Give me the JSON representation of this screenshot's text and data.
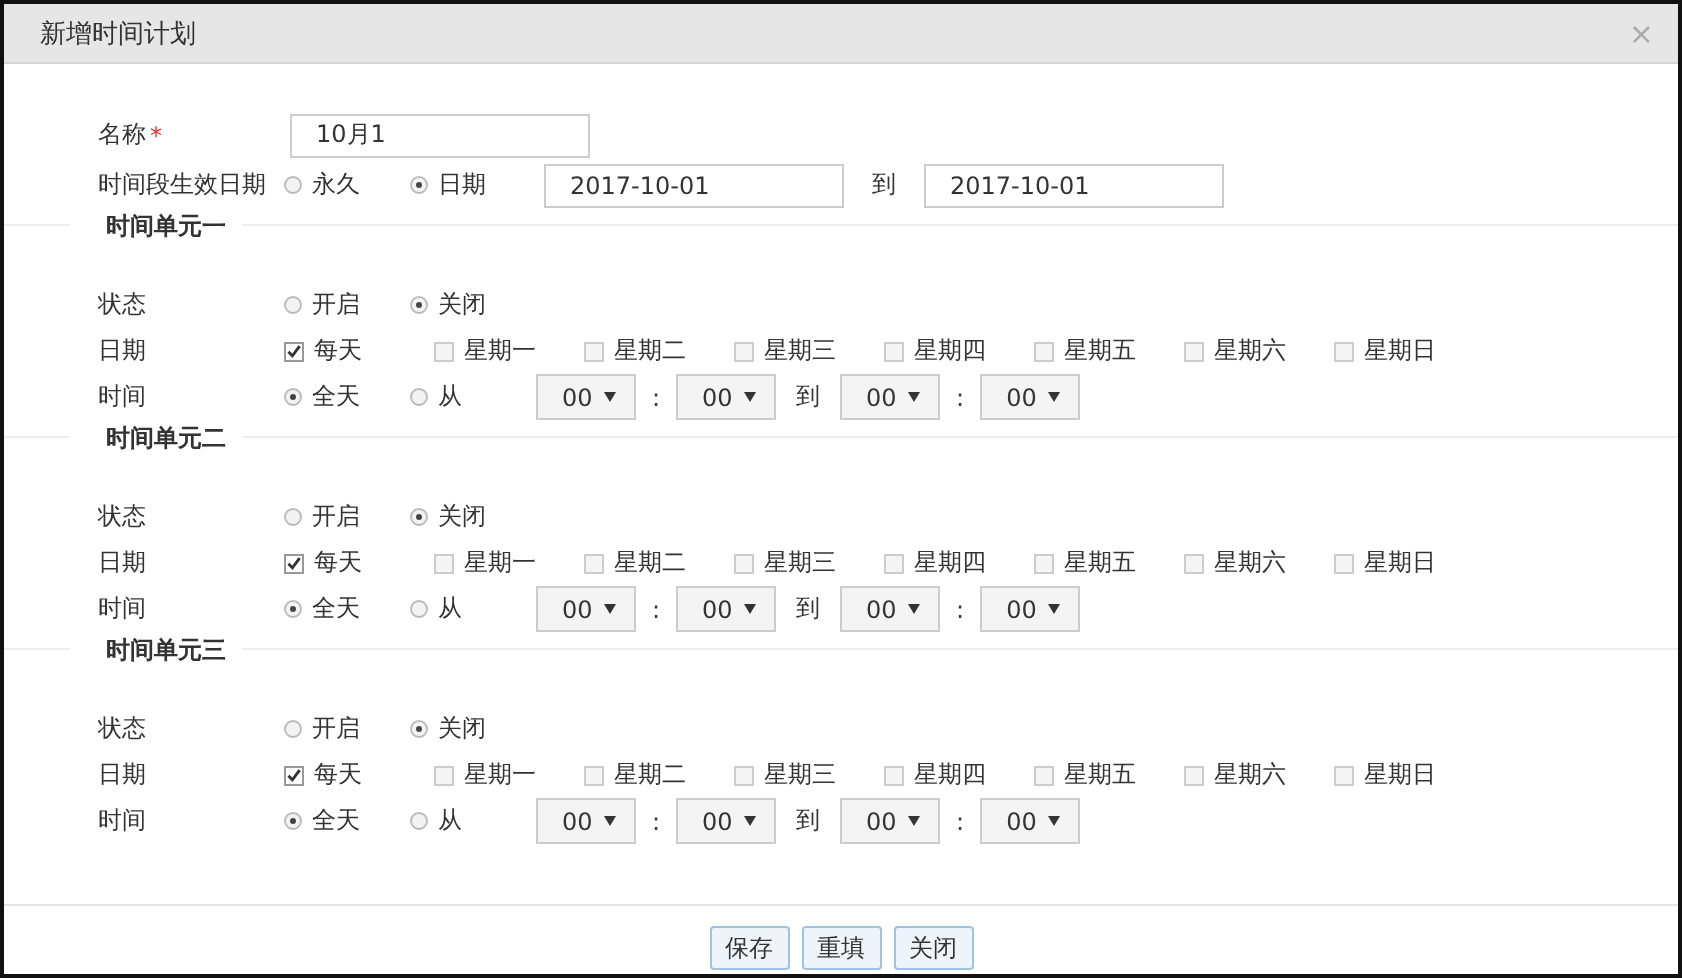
{
  "window": {
    "title": "新增时间计划",
    "close": "×"
  },
  "name": {
    "label": "名称",
    "required": "*",
    "value": "10月1"
  },
  "validity": {
    "label": "时间段生效日期",
    "options": [
      {
        "label": "永久",
        "selected": false
      },
      {
        "label": "日期",
        "selected": true
      }
    ],
    "from": "2017-10-01",
    "to_label": "到",
    "to": "2017-10-01"
  },
  "units": [
    {
      "title": "时间单元一",
      "status": {
        "label": "状态",
        "options": [
          {
            "label": "开启",
            "selected": false
          },
          {
            "label": "关闭",
            "selected": true
          }
        ]
      },
      "days": {
        "label": "日期",
        "items": [
          {
            "label": "每天",
            "checked": true
          },
          {
            "label": "星期一",
            "checked": false
          },
          {
            "label": "星期二",
            "checked": false
          },
          {
            "label": "星期三",
            "checked": false
          },
          {
            "label": "星期四",
            "checked": false
          },
          {
            "label": "星期五",
            "checked": false
          },
          {
            "label": "星期六",
            "checked": false
          },
          {
            "label": "星期日",
            "checked": false
          }
        ]
      },
      "time": {
        "label": "时间",
        "options": [
          {
            "label": "全天",
            "selected": true
          },
          {
            "label": "从",
            "selected": false
          }
        ],
        "start_hour": "00",
        "start_minute": "00",
        "to_label": "到",
        "end_hour": "00",
        "end_minute": "00",
        "sep": ":"
      }
    },
    {
      "title": "时间单元二",
      "status": {
        "label": "状态",
        "options": [
          {
            "label": "开启",
            "selected": false
          },
          {
            "label": "关闭",
            "selected": true
          }
        ]
      },
      "days": {
        "label": "日期",
        "items": [
          {
            "label": "每天",
            "checked": true
          },
          {
            "label": "星期一",
            "checked": false
          },
          {
            "label": "星期二",
            "checked": false
          },
          {
            "label": "星期三",
            "checked": false
          },
          {
            "label": "星期四",
            "checked": false
          },
          {
            "label": "星期五",
            "checked": false
          },
          {
            "label": "星期六",
            "checked": false
          },
          {
            "label": "星期日",
            "checked": false
          }
        ]
      },
      "time": {
        "label": "时间",
        "options": [
          {
            "label": "全天",
            "selected": true
          },
          {
            "label": "从",
            "selected": false
          }
        ],
        "start_hour": "00",
        "start_minute": "00",
        "to_label": "到",
        "end_hour": "00",
        "end_minute": "00",
        "sep": ":"
      }
    },
    {
      "title": "时间单元三",
      "status": {
        "label": "状态",
        "options": [
          {
            "label": "开启",
            "selected": false
          },
          {
            "label": "关闭",
            "selected": true
          }
        ]
      },
      "days": {
        "label": "日期",
        "items": [
          {
            "label": "每天",
            "checked": true
          },
          {
            "label": "星期一",
            "checked": false
          },
          {
            "label": "星期二",
            "checked": false
          },
          {
            "label": "星期三",
            "checked": false
          },
          {
            "label": "星期四",
            "checked": false
          },
          {
            "label": "星期五",
            "checked": false
          },
          {
            "label": "星期六",
            "checked": false
          },
          {
            "label": "星期日",
            "checked": false
          }
        ]
      },
      "time": {
        "label": "时间",
        "options": [
          {
            "label": "全天",
            "selected": true
          },
          {
            "label": "从",
            "selected": false
          }
        ],
        "start_hour": "00",
        "start_minute": "00",
        "to_label": "到",
        "end_hour": "00",
        "end_minute": "00",
        "sep": ":"
      }
    }
  ],
  "buttons": [
    "保存",
    "重填",
    "关闭"
  ]
}
